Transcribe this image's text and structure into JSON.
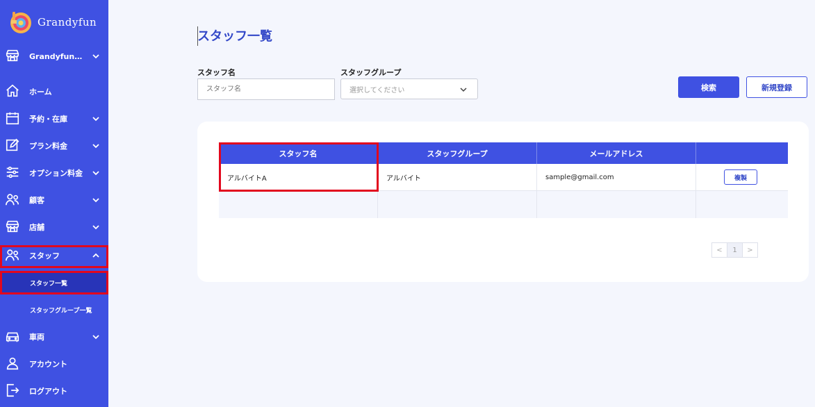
{
  "app": {
    "logo_text": "Grandyfun"
  },
  "sidebar": {
    "store_selector": "Grandyfun…",
    "items": [
      {
        "label": "ホーム"
      },
      {
        "label": "予約・在庫"
      },
      {
        "label": "プラン料金"
      },
      {
        "label": "オプション料金"
      },
      {
        "label": "顧客"
      },
      {
        "label": "店舗"
      },
      {
        "label": "スタッフ"
      },
      {
        "label": "車両"
      },
      {
        "label": "アカウント"
      },
      {
        "label": "ログアウト"
      }
    ],
    "sub_items": [
      {
        "label": "スタッフ一覧"
      },
      {
        "label": "スタッフグループ一覧"
      }
    ]
  },
  "page": {
    "title": "スタッフ一覧"
  },
  "search": {
    "name_label": "スタッフ名",
    "name_placeholder": "スタッフ名",
    "group_label": "スタッフグループ",
    "group_selected": "選択してください",
    "search_button": "検索",
    "new_button": "新規登録"
  },
  "table": {
    "headers": [
      "スタッフ名",
      "スタッフグループ",
      "メールアドレス",
      ""
    ],
    "rows": [
      {
        "name": "アルバイトA",
        "group": "アルバイト",
        "email": "sample@gmail.com",
        "action": "複製"
      }
    ]
  },
  "pagination": {
    "prev": "<",
    "current": "1",
    "next": ">"
  },
  "colors": {
    "primary": "#3f51e2",
    "highlight": "#e2081e",
    "active_sub": "#2834b8"
  }
}
